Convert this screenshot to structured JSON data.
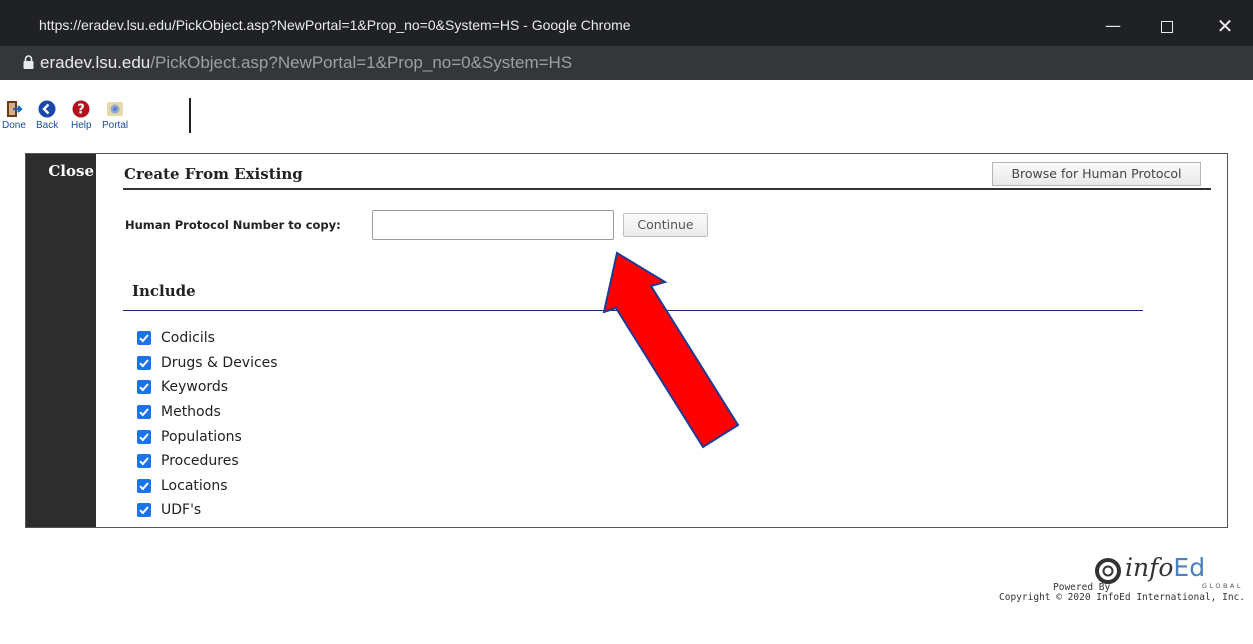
{
  "window": {
    "title": "https://eradev.lsu.edu/PickObject.asp?NewPortal=1&Prop_no=0&System=HS - Google Chrome",
    "minimize_glyph": "—",
    "close_glyph": "✕"
  },
  "urlbar": {
    "host": "eradev.lsu.edu",
    "path": "/PickObject.asp?NewPortal=1&Prop_no=0&System=HS"
  },
  "toolbar": {
    "items": [
      {
        "label": "Done",
        "icon": "done-icon"
      },
      {
        "label": "Back",
        "icon": "back-icon"
      },
      {
        "label": "Help",
        "icon": "help-icon"
      },
      {
        "label": "Portal",
        "icon": "portal-icon"
      }
    ]
  },
  "sidebar": {
    "close_label": "Close"
  },
  "form": {
    "section_title": "Create From Existing",
    "browse_button": "Browse for Human Protocol",
    "protocol_label": "Human Protocol Number to copy:",
    "protocol_value": "",
    "continue_button": "Continue",
    "include_title": "Include",
    "include_items": [
      {
        "label": "Codicils",
        "checked": true
      },
      {
        "label": "Drugs & Devices",
        "checked": true
      },
      {
        "label": "Keywords",
        "checked": true
      },
      {
        "label": "Methods",
        "checked": true
      },
      {
        "label": "Populations",
        "checked": true
      },
      {
        "label": "Procedures",
        "checked": true
      },
      {
        "label": "Locations",
        "checked": true
      },
      {
        "label": "UDF's",
        "checked": true
      }
    ]
  },
  "footer": {
    "logo_info": "info",
    "logo_ed": "Ed",
    "logo_global": "GLOBAL",
    "powered_by": "Powered By",
    "copyright": "Copyright © 2020 InfoEd International, Inc."
  },
  "colors": {
    "annotation_arrow": "#ff0000",
    "checkbox": "#1a73e8",
    "titlebar": "#202124"
  }
}
